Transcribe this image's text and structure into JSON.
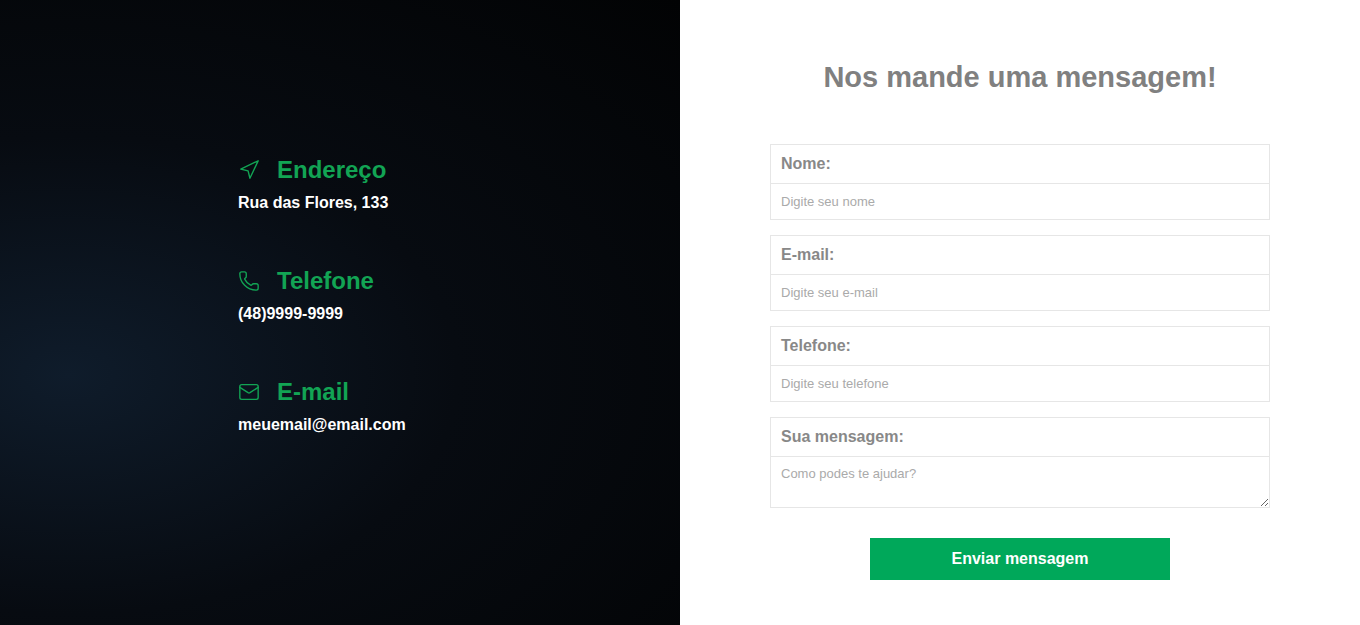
{
  "contact": {
    "items": [
      {
        "title": "Endereço",
        "value": "Rua das Flores, 133"
      },
      {
        "title": "Telefone",
        "value": "(48)9999-9999"
      },
      {
        "title": "E-mail",
        "value": "meuemail@email.com"
      }
    ]
  },
  "form": {
    "title": "Nos mande uma mensagem!",
    "fields": [
      {
        "label": "Nome:",
        "placeholder": "Digite seu nome",
        "kind": "input"
      },
      {
        "label": "E-mail:",
        "placeholder": "Digite seu e-mail",
        "kind": "input"
      },
      {
        "label": "Telefone:",
        "placeholder": "Digite seu telefone",
        "kind": "input"
      },
      {
        "label": "Sua mensagem:",
        "placeholder": "Como podes te ajudar?",
        "kind": "textarea"
      }
    ],
    "submit": "Enviar mensagem"
  }
}
